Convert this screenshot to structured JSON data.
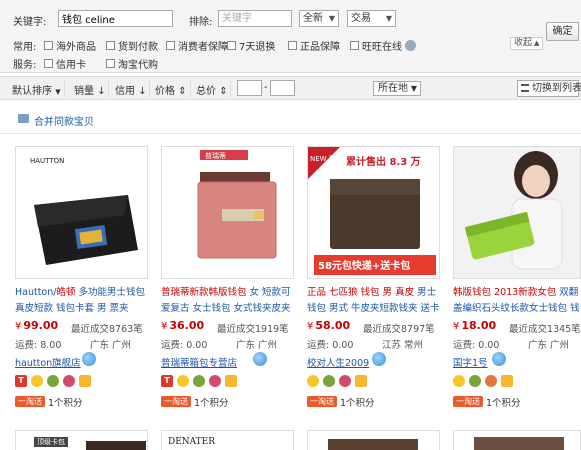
{
  "filter": {
    "keyword_label": "关键字:",
    "keyword_value": "钱包 celine",
    "exclude_label": "排除:",
    "exclude_placeholder": "关键字",
    "scope_select": "全新",
    "trade_select": "交易",
    "confirm_button": "确定",
    "common_label": "常用:",
    "service_label": "服务:",
    "collapse_button": "收起",
    "checkboxes_common": [
      "海外商品",
      "货到付款",
      "消费者保障",
      "7天退换",
      "正品保障",
      "旺旺在线"
    ],
    "checkboxes_service": [
      "信用卡",
      "淘宝代购"
    ]
  },
  "sortbar": {
    "default_sort": "默认排序",
    "sales": "销量",
    "credit": "信用",
    "price": "价格",
    "total_price": "总价",
    "price_sep": "-",
    "location": "所在地",
    "list_view": "切换到列表"
  },
  "merge": {
    "label": "合并同款宝贝"
  },
  "products": [
    {
      "brand_top": "HAUTTON",
      "title_before": "Hautton/",
      "title_highlight": "皓顿",
      "title_after": " 多功能男士钱包真皮短款 钱包卡套 男 票夹",
      "price_currency": "¥",
      "price": "99.00",
      "sold": "最近成交8763笔",
      "shipping": "运费: 8.00",
      "location": "广东 广州",
      "shop": "hautton旗舰店",
      "promo_tag": "一淘送",
      "points": "1个积分"
    },
    {
      "brand_top": "普瑞蒂",
      "title_before": "",
      "title_highlight": "普瑞蒂新款韩版钱包",
      "title_after": " 女 短款可爱复古 女士钱包 女式钱夹皮夹",
      "price_currency": "¥",
      "price": "36.00",
      "sold": "最近成交1919笔",
      "shipping": "运费: 0.00",
      "location": "广东 广州",
      "shop": "普瑞蒂箱包专营店",
      "promo_tag": "一淘送",
      "points": "1个积分"
    },
    {
      "badge_new": "NEW 现货上市",
      "badge_sales": "累计售出 8.3 万",
      "badge_bottom": "58元包快递+送卡包",
      "title_before": "",
      "title_highlight": "正品 七匹狼 钱包 男 真皮",
      "title_after": " 男士钱包 男式 牛皮夹短款钱夹 送卡",
      "price_currency": "¥",
      "price": "58.00",
      "sold": "最近成交8797笔",
      "shipping": "运费: 0.00",
      "location": "江苏 常州",
      "shop": "校对人生2009",
      "promo_tag": "一淘送",
      "points": "1个积分"
    },
    {
      "title_before": "",
      "title_highlight": "韩版钱包 2013新款女包",
      "title_after": " 双翻盖编织石头纹长款女士钱包 钱包 女",
      "price_currency": "¥",
      "price": "18.00",
      "sold": "最近成交1345笔",
      "shipping": "运费: 0.00",
      "location": "广东 广州",
      "shop": "国字1号",
      "promo_tag": "一淘送",
      "points": "1个积分"
    }
  ],
  "row2": [
    {
      "label": "顶级卡包"
    },
    {
      "label": "DENATER"
    },
    {
      "label": ""
    },
    {
      "label": ""
    }
  ],
  "colors": {
    "link": "#1c56a8",
    "price": "#c40000",
    "accent_orange": "#e85b2c"
  }
}
